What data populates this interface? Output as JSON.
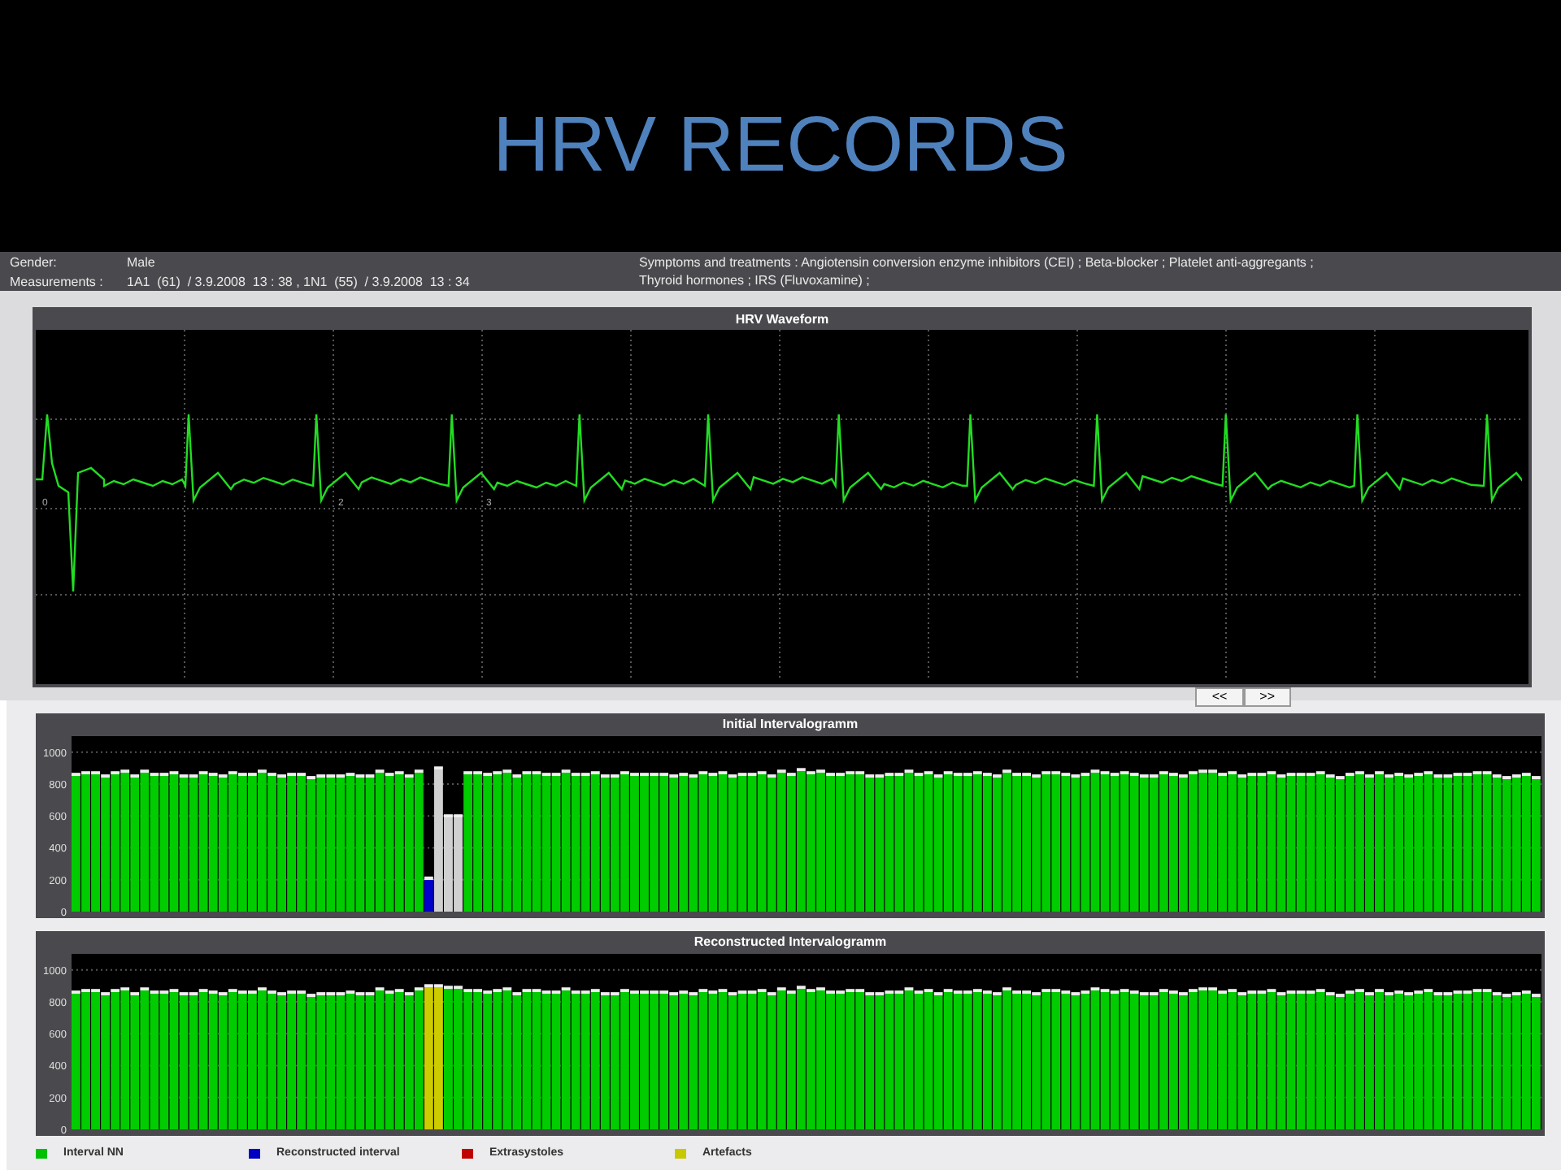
{
  "slide_title": "HRV RECORDS",
  "patient_info": {
    "left": [
      {
        "label": "Gender:",
        "value": "Male"
      },
      {
        "label": "Measurements :",
        "value": "1A1  (61)  / 3.9.2008  13 : 38 , 1N1  (55)  / 3.9.2008  13 : 34"
      }
    ],
    "right": [
      "Symptoms and treatments : Angiotensin conversion enzyme inhibitors (CEI) ; Beta-blocker ; Platelet anti-aggregants ;",
      "Thyroid hormones ; IRS (Fluvoxamine) ;"
    ]
  },
  "waveform": {
    "title": "HRV Waveform",
    "markers": [
      "0",
      "2",
      "3"
    ],
    "buttons": [
      "<<",
      ">>"
    ]
  },
  "charts": [
    {
      "chart_data": {
        "type": "bar",
        "title": "Initial  Intervalogramm",
        "ylim": [
          0,
          1100
        ],
        "yticks": [
          0,
          200,
          400,
          600,
          800,
          1000
        ],
        "grid": true,
        "series": [
          {
            "color": "#00cc00",
            "values": [
              870,
              880,
              880,
              860,
              880,
              890,
              860,
              890,
              870,
              870,
              880,
              860,
              860,
              880,
              870,
              860,
              880,
              870,
              870,
              890,
              870,
              860,
              870,
              870,
              850,
              860,
              860,
              860,
              870,
              860,
              860,
              890,
              870,
              880,
              860,
              890,
              null,
              null,
              null,
              null,
              880,
              880,
              870,
              880,
              890,
              860,
              880,
              880,
              870,
              870,
              890,
              870,
              870,
              880,
              860,
              860,
              880,
              870,
              870,
              870,
              870,
              860,
              870,
              860,
              880,
              870,
              880,
              860,
              870,
              870,
              880,
              860,
              890,
              870,
              900,
              880,
              890,
              870,
              870,
              880,
              880,
              860,
              860,
              870,
              870,
              890,
              870,
              880,
              860,
              880,
              870,
              870,
              880,
              870,
              860,
              890,
              870,
              870,
              860,
              880,
              880,
              870,
              860,
              870,
              890,
              880,
              870,
              880,
              870,
              860,
              860,
              880,
              870,
              860,
              880,
              890,
              890,
              870,
              880,
              860,
              870,
              870,
              880,
              860,
              870,
              870,
              870,
              880,
              860,
              850,
              870,
              880,
              860,
              880,
              860,
              870,
              860,
              870,
              880,
              860,
              860,
              870,
              870,
              880,
              880,
              860,
              850,
              860,
              870,
              850
            ]
          },
          {
            "color": "#0000cc",
            "values": [
              null,
              null,
              null,
              null,
              null,
              null,
              null,
              null,
              null,
              null,
              null,
              null,
              null,
              null,
              null,
              null,
              null,
              null,
              null,
              null,
              null,
              null,
              null,
              null,
              null,
              null,
              null,
              null,
              null,
              null,
              null,
              null,
              null,
              null,
              null,
              null,
              220
            ]
          },
          {
            "color": "#d0d0d0",
            "values": [
              null,
              null,
              null,
              null,
              null,
              null,
              null,
              null,
              null,
              null,
              null,
              null,
              null,
              null,
              null,
              null,
              null,
              null,
              null,
              null,
              null,
              null,
              null,
              null,
              null,
              null,
              null,
              null,
              null,
              null,
              null,
              null,
              null,
              null,
              null,
              null,
              null,
              910,
              610,
              610
            ]
          }
        ]
      }
    },
    {
      "chart_data": {
        "type": "bar",
        "title": "Reconstructed Intervalogramm",
        "ylim": [
          0,
          1100
        ],
        "yticks": [
          0,
          200,
          400,
          600,
          800,
          1000
        ],
        "grid": true,
        "series": [
          {
            "color": "#00cc00",
            "values": [
              870,
              880,
              880,
              860,
              880,
              890,
              860,
              890,
              870,
              870,
              880,
              860,
              860,
              880,
              870,
              860,
              880,
              870,
              870,
              890,
              870,
              860,
              870,
              870,
              850,
              860,
              860,
              860,
              870,
              860,
              860,
              890,
              870,
              880,
              860,
              890,
              null,
              null,
              900,
              900,
              880,
              880,
              870,
              880,
              890,
              860,
              880,
              880,
              870,
              870,
              890,
              870,
              870,
              880,
              860,
              860,
              880,
              870,
              870,
              870,
              870,
              860,
              870,
              860,
              880,
              870,
              880,
              860,
              870,
              870,
              880,
              860,
              890,
              870,
              900,
              880,
              890,
              870,
              870,
              880,
              880,
              860,
              860,
              870,
              870,
              890,
              870,
              880,
              860,
              880,
              870,
              870,
              880,
              870,
              860,
              890,
              870,
              870,
              860,
              880,
              880,
              870,
              860,
              870,
              890,
              880,
              870,
              880,
              870,
              860,
              860,
              880,
              870,
              860,
              880,
              890,
              890,
              870,
              880,
              860,
              870,
              870,
              880,
              860,
              870,
              870,
              870,
              880,
              860,
              850,
              870,
              880,
              860,
              880,
              860,
              870,
              860,
              870,
              880,
              860,
              860,
              870,
              870,
              880,
              880,
              860,
              850,
              860,
              870,
              850
            ]
          },
          {
            "color": "#cccc00",
            "values": [
              null,
              null,
              null,
              null,
              null,
              null,
              null,
              null,
              null,
              null,
              null,
              null,
              null,
              null,
              null,
              null,
              null,
              null,
              null,
              null,
              null,
              null,
              null,
              null,
              null,
              null,
              null,
              null,
              null,
              null,
              null,
              null,
              null,
              null,
              null,
              null,
              910,
              910
            ]
          }
        ]
      }
    }
  ],
  "legend": [
    {
      "label": "Interval NN",
      "color": "#00c000"
    },
    {
      "label": "Reconstructed interval",
      "color": "#0000c0"
    },
    {
      "label": "Extrasystoles",
      "color": "#c00000"
    },
    {
      "label": "Artefacts",
      "color": "#c8c800"
    }
  ]
}
